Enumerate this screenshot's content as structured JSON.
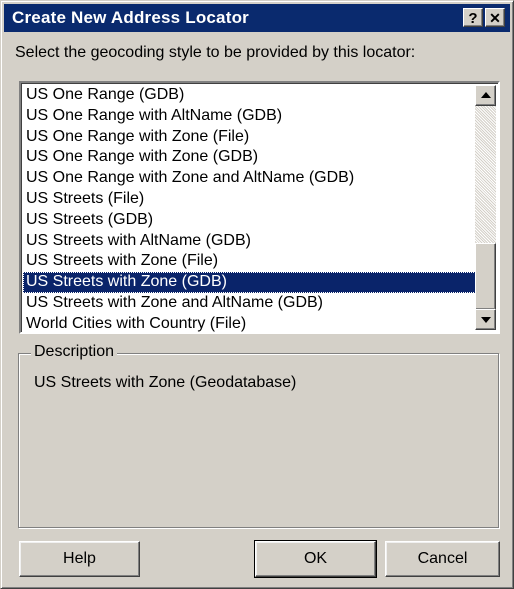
{
  "window": {
    "title": "Create New Address Locator",
    "help_button": "?",
    "close_button": "✕"
  },
  "prompt": "Select the geocoding style to be provided by this locator:",
  "styles_list": {
    "items": [
      "US One Range (GDB)",
      "US One Range with AltName (GDB)",
      "US One Range with Zone (File)",
      "US One Range with Zone (GDB)",
      "US One Range with Zone and AltName (GDB)",
      "US Streets (File)",
      "US Streets (GDB)",
      "US Streets with AltName (GDB)",
      "US Streets with Zone (File)",
      "US Streets with Zone (GDB)",
      "US Streets with Zone and AltName (GDB)",
      "World Cities with Country (File)"
    ],
    "selected_index": 9
  },
  "description": {
    "label": "Description",
    "text": "US Streets with Zone (Geodatabase)"
  },
  "buttons": {
    "help": "Help",
    "ok": "OK",
    "cancel": "Cancel"
  }
}
